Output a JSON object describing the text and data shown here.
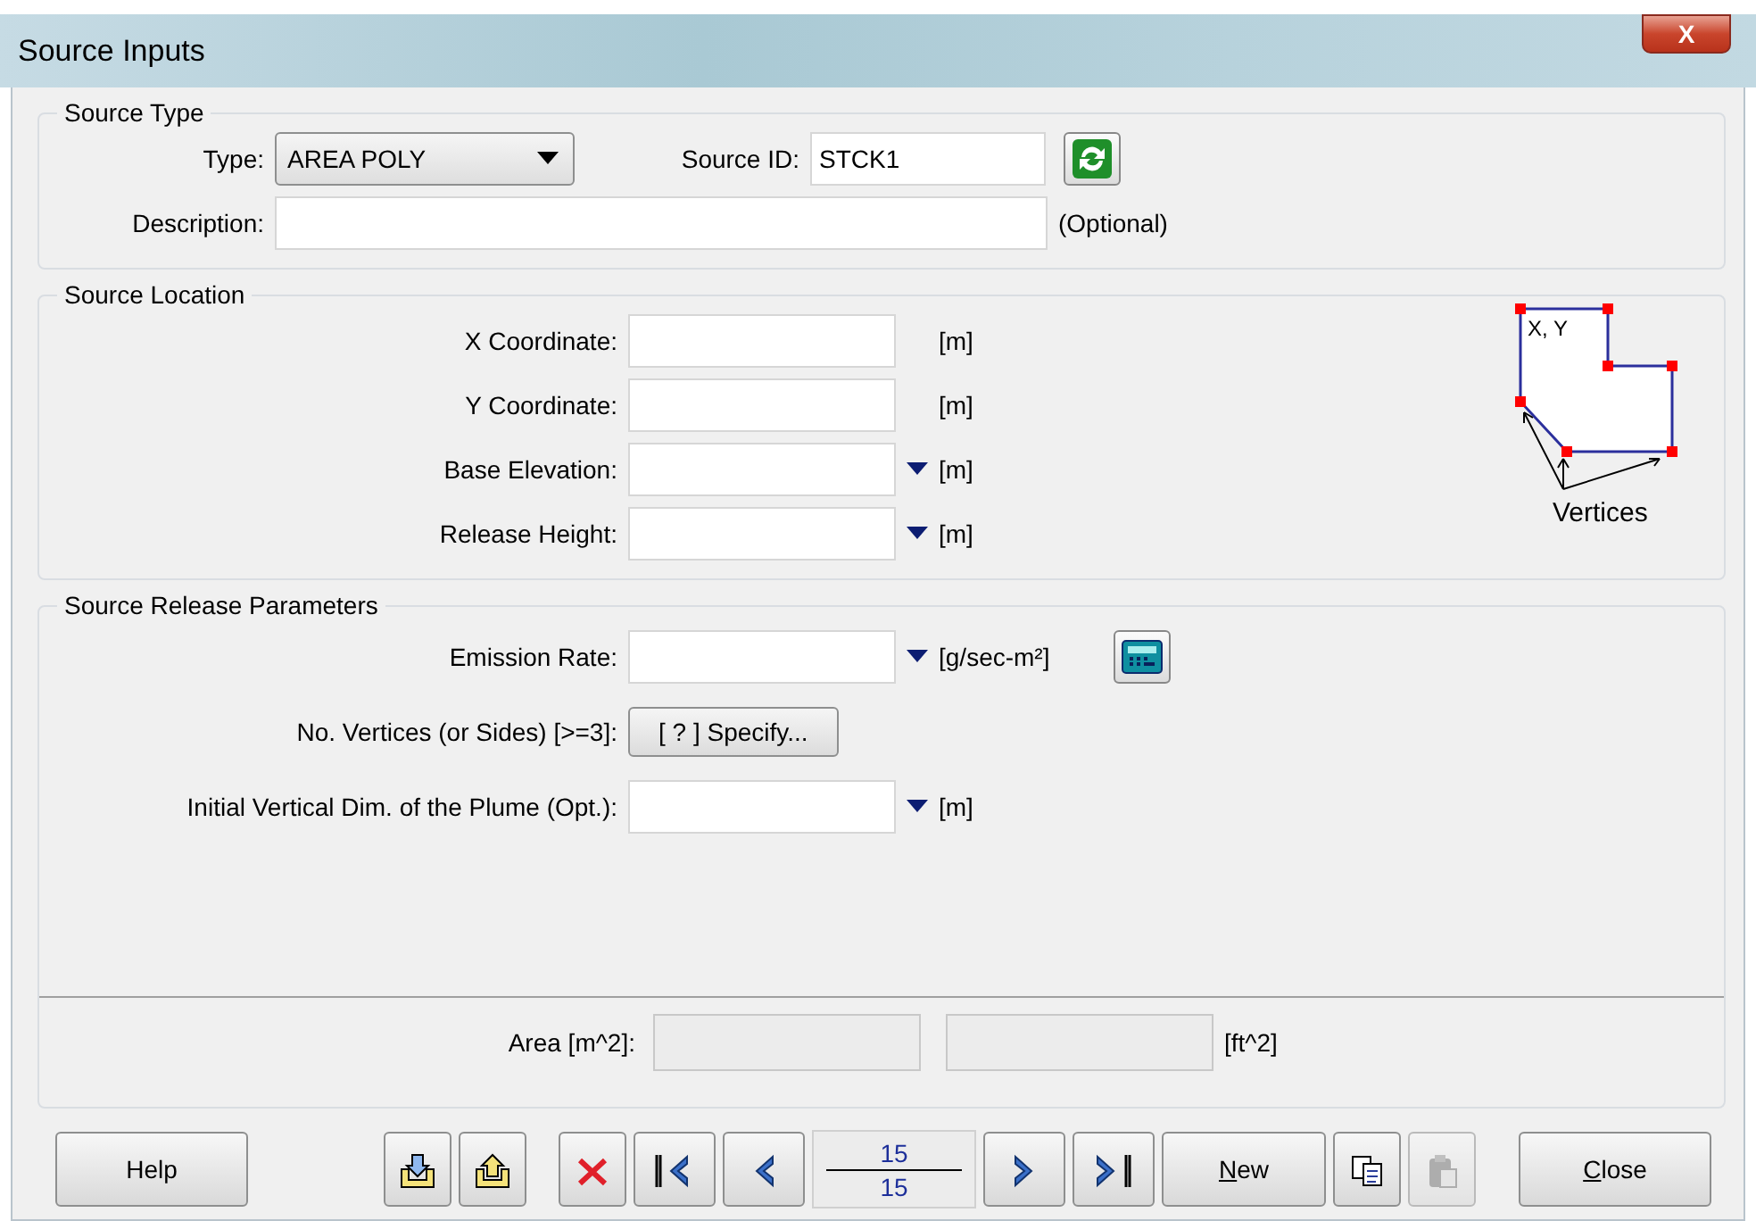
{
  "window": {
    "title": "Source Inputs",
    "close_label": "X"
  },
  "source_type": {
    "title": "Source Type",
    "type_label": "Type:",
    "type_value": "AREA POLY",
    "id_label": "Source ID:",
    "id_value": "STCK1",
    "description_label": "Description:",
    "optional": "(Optional)"
  },
  "source_location": {
    "title": "Source Location",
    "fields": [
      {
        "label": "X Coordinate:",
        "unit": "[m]",
        "has_menu": false
      },
      {
        "label": "Y Coordinate:",
        "unit": "[m]",
        "has_menu": false
      },
      {
        "label": "Base Elevation:",
        "unit": "[m]",
        "has_menu": true
      },
      {
        "label": "Release Height:",
        "unit": "[m]",
        "has_menu": true
      }
    ],
    "diagram": {
      "corner_label": "X, Y",
      "vertices_label": "Vertices"
    }
  },
  "release_parameters": {
    "title": "Source Release Parameters",
    "rows": [
      {
        "kind": "field",
        "label": "Emission Rate:",
        "unit": "[g/sec-m²]",
        "has_menu": true,
        "calculator": true
      },
      {
        "kind": "button",
        "label": "No. Vertices (or Sides) [>=3]:",
        "button": "[ ? ]  Specify..."
      },
      {
        "kind": "field",
        "label": "Initial Vertical Dim. of the Plume (Opt.):",
        "unit": "[m]",
        "has_menu": true,
        "calculator": false
      }
    ],
    "area_label": "Area [m^2]:",
    "area_unit": "[ft^2]"
  },
  "toolbar": [
    {
      "kind": "text",
      "label": "Help",
      "mnemonic": false,
      "disabled": false
    },
    {
      "kind": "import",
      "disabled": false
    },
    {
      "kind": "export",
      "disabled": false
    },
    {
      "kind": "delete",
      "disabled": false
    },
    {
      "kind": "first",
      "disabled": false
    },
    {
      "kind": "prev",
      "disabled": false
    },
    {
      "kind": "counter",
      "current": "15",
      "total": "15"
    },
    {
      "kind": "next",
      "disabled": false
    },
    {
      "kind": "last",
      "disabled": false
    },
    {
      "kind": "text",
      "label": "New",
      "mnemonic": true,
      "disabled": false
    },
    {
      "kind": "copy",
      "disabled": false
    },
    {
      "kind": "paste",
      "disabled": true
    },
    {
      "kind": "text",
      "label": "Close",
      "mnemonic": true,
      "disabled": false
    }
  ]
}
